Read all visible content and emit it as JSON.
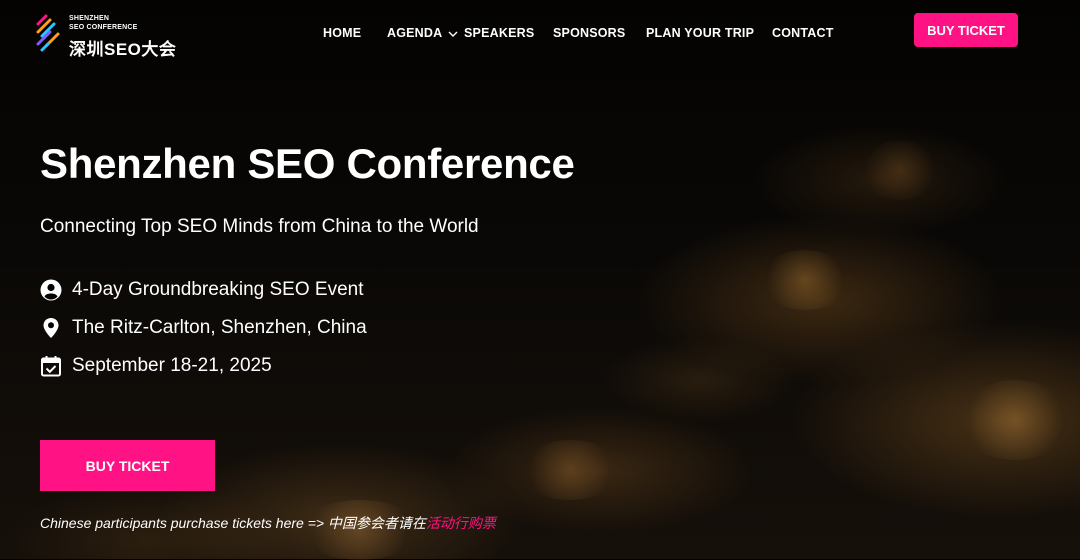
{
  "logo": {
    "line1": "SHENZHEN",
    "line2": "SEO CONFERENCE",
    "main": "深圳SEO大会"
  },
  "nav": {
    "items": [
      {
        "label": "HOME"
      },
      {
        "label": "AGENDA"
      },
      {
        "label": "SPEAKERS"
      },
      {
        "label": "SPONSORS"
      },
      {
        "label": "PLAN YOUR TRIP"
      },
      {
        "label": "CONTACT"
      }
    ]
  },
  "header": {
    "buy_label": "BUY TICKET"
  },
  "hero": {
    "title": "Shenzhen SEO Conference",
    "subtitle": "Connecting Top SEO Minds from China to the World",
    "features": [
      {
        "icon": "user-circle-icon",
        "text": "4-Day Groundbreaking SEO Event"
      },
      {
        "icon": "map-pin-icon",
        "text": "The Ritz-Carlton, Shenzhen, China"
      },
      {
        "icon": "calendar-check-icon",
        "text": "September 18-21, 2025"
      }
    ],
    "buy_label": "BUY TICKET",
    "note_prefix": "Chinese participants purchase tickets here => 中国参会者请在",
    "note_link": "活动行购票"
  },
  "colors": {
    "accent": "#ff1384",
    "background": "#050403",
    "text": "#ffffff"
  }
}
